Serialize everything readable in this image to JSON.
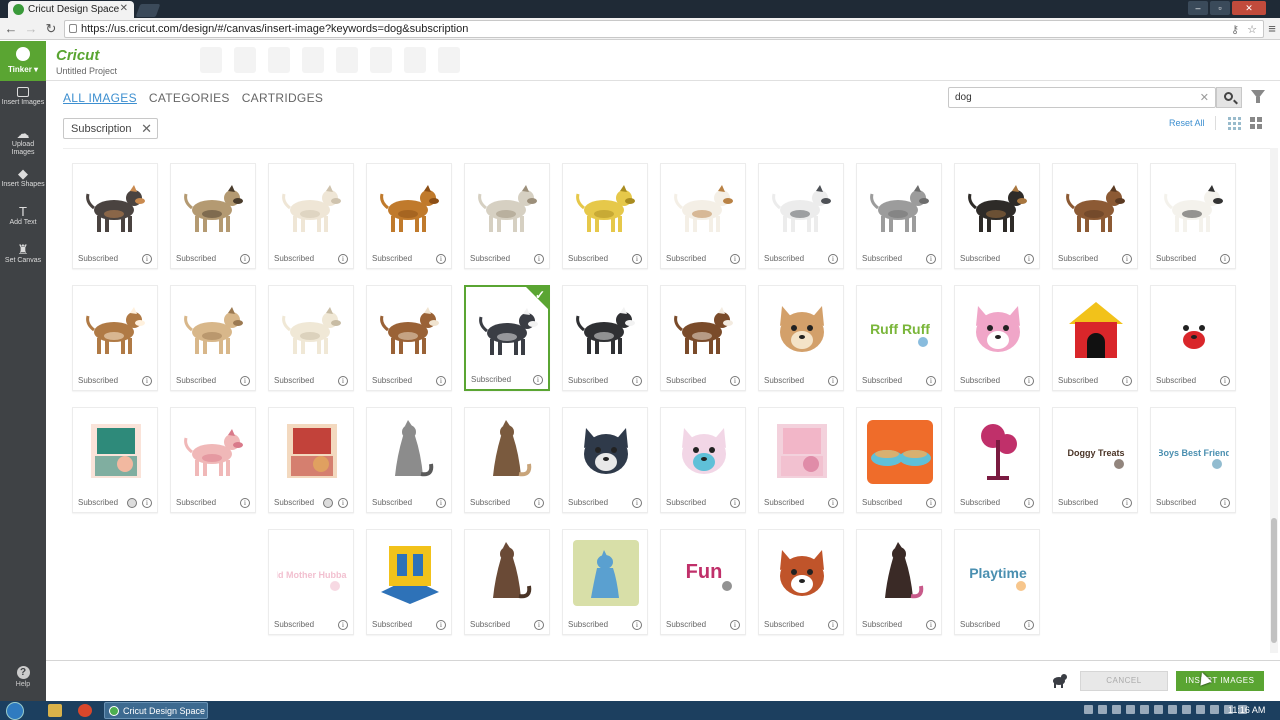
{
  "browser": {
    "tab_title": "Cricut Design Space",
    "url": "https://us.cricut.com/design/#/canvas/insert-image?keywords=dog&subscription"
  },
  "app": {
    "logo": "Cricut",
    "project_name": "Untitled Project",
    "user_menu": "Tinker"
  },
  "sidebar": {
    "items": [
      {
        "label": "Insert Images",
        "icon": "image-icon"
      },
      {
        "label": "Upload Images",
        "icon": "cloud-upload-icon"
      },
      {
        "label": "Insert Shapes",
        "icon": "shapes-icon"
      },
      {
        "label": "Add Text",
        "icon": "text-icon"
      },
      {
        "label": "Set Canvas",
        "icon": "shirt-icon"
      }
    ],
    "help": "Help"
  },
  "panel": {
    "tabs": [
      "ALL IMAGES",
      "CATEGORIES",
      "CARTRIDGES"
    ],
    "active_tab": "ALL IMAGES",
    "search_value": "dog",
    "filter_chip": "Subscription",
    "reset_all": "Reset All"
  },
  "tile_label": "Subscribed",
  "images": [
    {
      "name": "rottweiler",
      "color": "#4a4340",
      "accent": "#c98a4f",
      "shape": "dog"
    },
    {
      "name": "pug",
      "color": "#b49a72",
      "accent": "#4a3c2c",
      "shape": "dog"
    },
    {
      "name": "poodle",
      "color": "#efe6d6",
      "accent": "#cfc3ae",
      "shape": "dog"
    },
    {
      "name": "pomeranian",
      "color": "#c07a2c",
      "accent": "#8c4f16",
      "shape": "dog"
    },
    {
      "name": "pit-bull",
      "color": "#d6d0c2",
      "accent": "#9c8f7a",
      "shape": "dog"
    },
    {
      "name": "labrador",
      "color": "#e6c84a",
      "accent": "#a98c20",
      "shape": "dog"
    },
    {
      "name": "jack-russell",
      "color": "#f4efe6",
      "accent": "#b98245",
      "shape": "dog"
    },
    {
      "name": "husky",
      "color": "#ececec",
      "accent": "#4e5156",
      "shape": "dog"
    },
    {
      "name": "greyhound",
      "color": "#9c9c9c",
      "accent": "#6d6d6d",
      "shape": "dog"
    },
    {
      "name": "german-shepherd",
      "color": "#2e2b28",
      "accent": "#a8763f",
      "shape": "dog"
    },
    {
      "name": "dachshund",
      "color": "#8c5a34",
      "accent": "#5b3a22",
      "shape": "dog"
    },
    {
      "name": "dalmatian",
      "color": "#f4f2ec",
      "accent": "#333333",
      "shape": "dog"
    },
    {
      "name": "collie",
      "color": "#b07a45",
      "accent": "#fff1de",
      "shape": "dog"
    },
    {
      "name": "chihuahua",
      "color": "#d8b78a",
      "accent": "#9c7a52",
      "shape": "dog"
    },
    {
      "name": "bulldog",
      "color": "#f0e8d6",
      "accent": "#c8bca4",
      "shape": "dog"
    },
    {
      "name": "boxer",
      "color": "#9a6236",
      "accent": "#f0e3cf",
      "shape": "dog"
    },
    {
      "name": "boston-terrier",
      "color": "#3a3d44",
      "accent": "#f2f2f2",
      "shape": "dog"
    },
    {
      "name": "border-collie",
      "color": "#2f3033",
      "accent": "#f2f2f2",
      "shape": "dog"
    },
    {
      "name": "spaniel",
      "color": "#7a4b2a",
      "accent": "#f3ebe0",
      "shape": "dog"
    },
    {
      "name": "chihuahua-face",
      "color": "#d3a06a",
      "accent": "#f4e3c8",
      "shape": "face"
    },
    {
      "name": "ruff-ruff",
      "color": "#7ab63a",
      "accent": "#3a8fc8",
      "shape": "text",
      "text": "Ruff Ruff"
    },
    {
      "name": "pink-poodle",
      "color": "#f0a6c8",
      "accent": "#ffffff",
      "shape": "face"
    },
    {
      "name": "dog-house",
      "color": "#d9262a",
      "accent": "#f2c21a",
      "shape": "house"
    },
    {
      "name": "firehouse-dog",
      "color": "#ffffff",
      "accent": "#d9262a",
      "shape": "face"
    },
    {
      "name": "window-scene",
      "color": "#2e8a7a",
      "accent": "#f2b8a0",
      "shape": "scene"
    },
    {
      "name": "pink-poodle-walk",
      "color": "#f0b8b8",
      "accent": "#d97a8a",
      "shape": "dog"
    },
    {
      "name": "girl-and-dog",
      "color": "#c2423a",
      "accent": "#e0a060",
      "shape": "scene"
    },
    {
      "name": "howling-wolf",
      "color": "#8c8c8c",
      "accent": "#5a5a5a",
      "shape": "sit"
    },
    {
      "name": "sitting-fox",
      "color": "#7a5a3e",
      "accent": "#c8a47a",
      "shape": "sit"
    },
    {
      "name": "wolf-head",
      "color": "#2f3a4a",
      "accent": "#e8e8e8",
      "shape": "face"
    },
    {
      "name": "lamb",
      "color": "#f2d6e6",
      "accent": "#5fc0d8",
      "shape": "face"
    },
    {
      "name": "pink-scene",
      "color": "#f2b6c8",
      "accent": "#e08ca8",
      "shape": "scene"
    },
    {
      "name": "food-bowls",
      "color": "#ef6c2a",
      "accent": "#5fc0d8",
      "shape": "bowls"
    },
    {
      "name": "pink-tree",
      "color": "#c0306a",
      "accent": "#7a1a40",
      "shape": "tree"
    },
    {
      "name": "doggy-treats",
      "color": "#4a3426",
      "accent": "#4a3426",
      "shape": "text",
      "text": "Doggy Treats"
    },
    {
      "name": "boys-best-friend",
      "color": "#4a8fb0",
      "accent": "#4a8fb0",
      "shape": "text",
      "text": "Boys Best Friend"
    },
    {
      "name": "mother-hubbard",
      "color": "#f2c0d0",
      "accent": "#f2c0d0",
      "shape": "text",
      "text": "Old Mother Hubbard"
    },
    {
      "name": "popup-card",
      "color": "#2e72b8",
      "accent": "#f2c21a",
      "shape": "card"
    },
    {
      "name": "howling-wolf-brown",
      "color": "#6a4a36",
      "accent": "#4a3426",
      "shape": "sit"
    },
    {
      "name": "blue-cat",
      "color": "#5aa0d0",
      "accent": "#d8dfa8",
      "shape": "stamp"
    },
    {
      "name": "fun",
      "color": "#c0306a",
      "accent": "#4a4a4a",
      "shape": "text",
      "text": "Fun"
    },
    {
      "name": "fox-cub",
      "color": "#c0542a",
      "accent": "#ffffff",
      "shape": "face"
    },
    {
      "name": "black-cat",
      "color": "#3a2a26",
      "accent": "#c85a8a",
      "shape": "sit"
    },
    {
      "name": "playtime",
      "color": "#4a8fb0",
      "accent": "#f2a040",
      "shape": "text",
      "text": "Playtime"
    }
  ],
  "selected_index": 16,
  "footer": {
    "cancel": "CANCEL",
    "insert": "INSERT IMAGES"
  },
  "taskbar": {
    "window": "Cricut Design Space ...",
    "clock": "11:16 AM"
  },
  "colors": {
    "brand_green": "#5aa532",
    "link_blue": "#3d8fd0",
    "sidebar_dark": "#3f4245"
  }
}
